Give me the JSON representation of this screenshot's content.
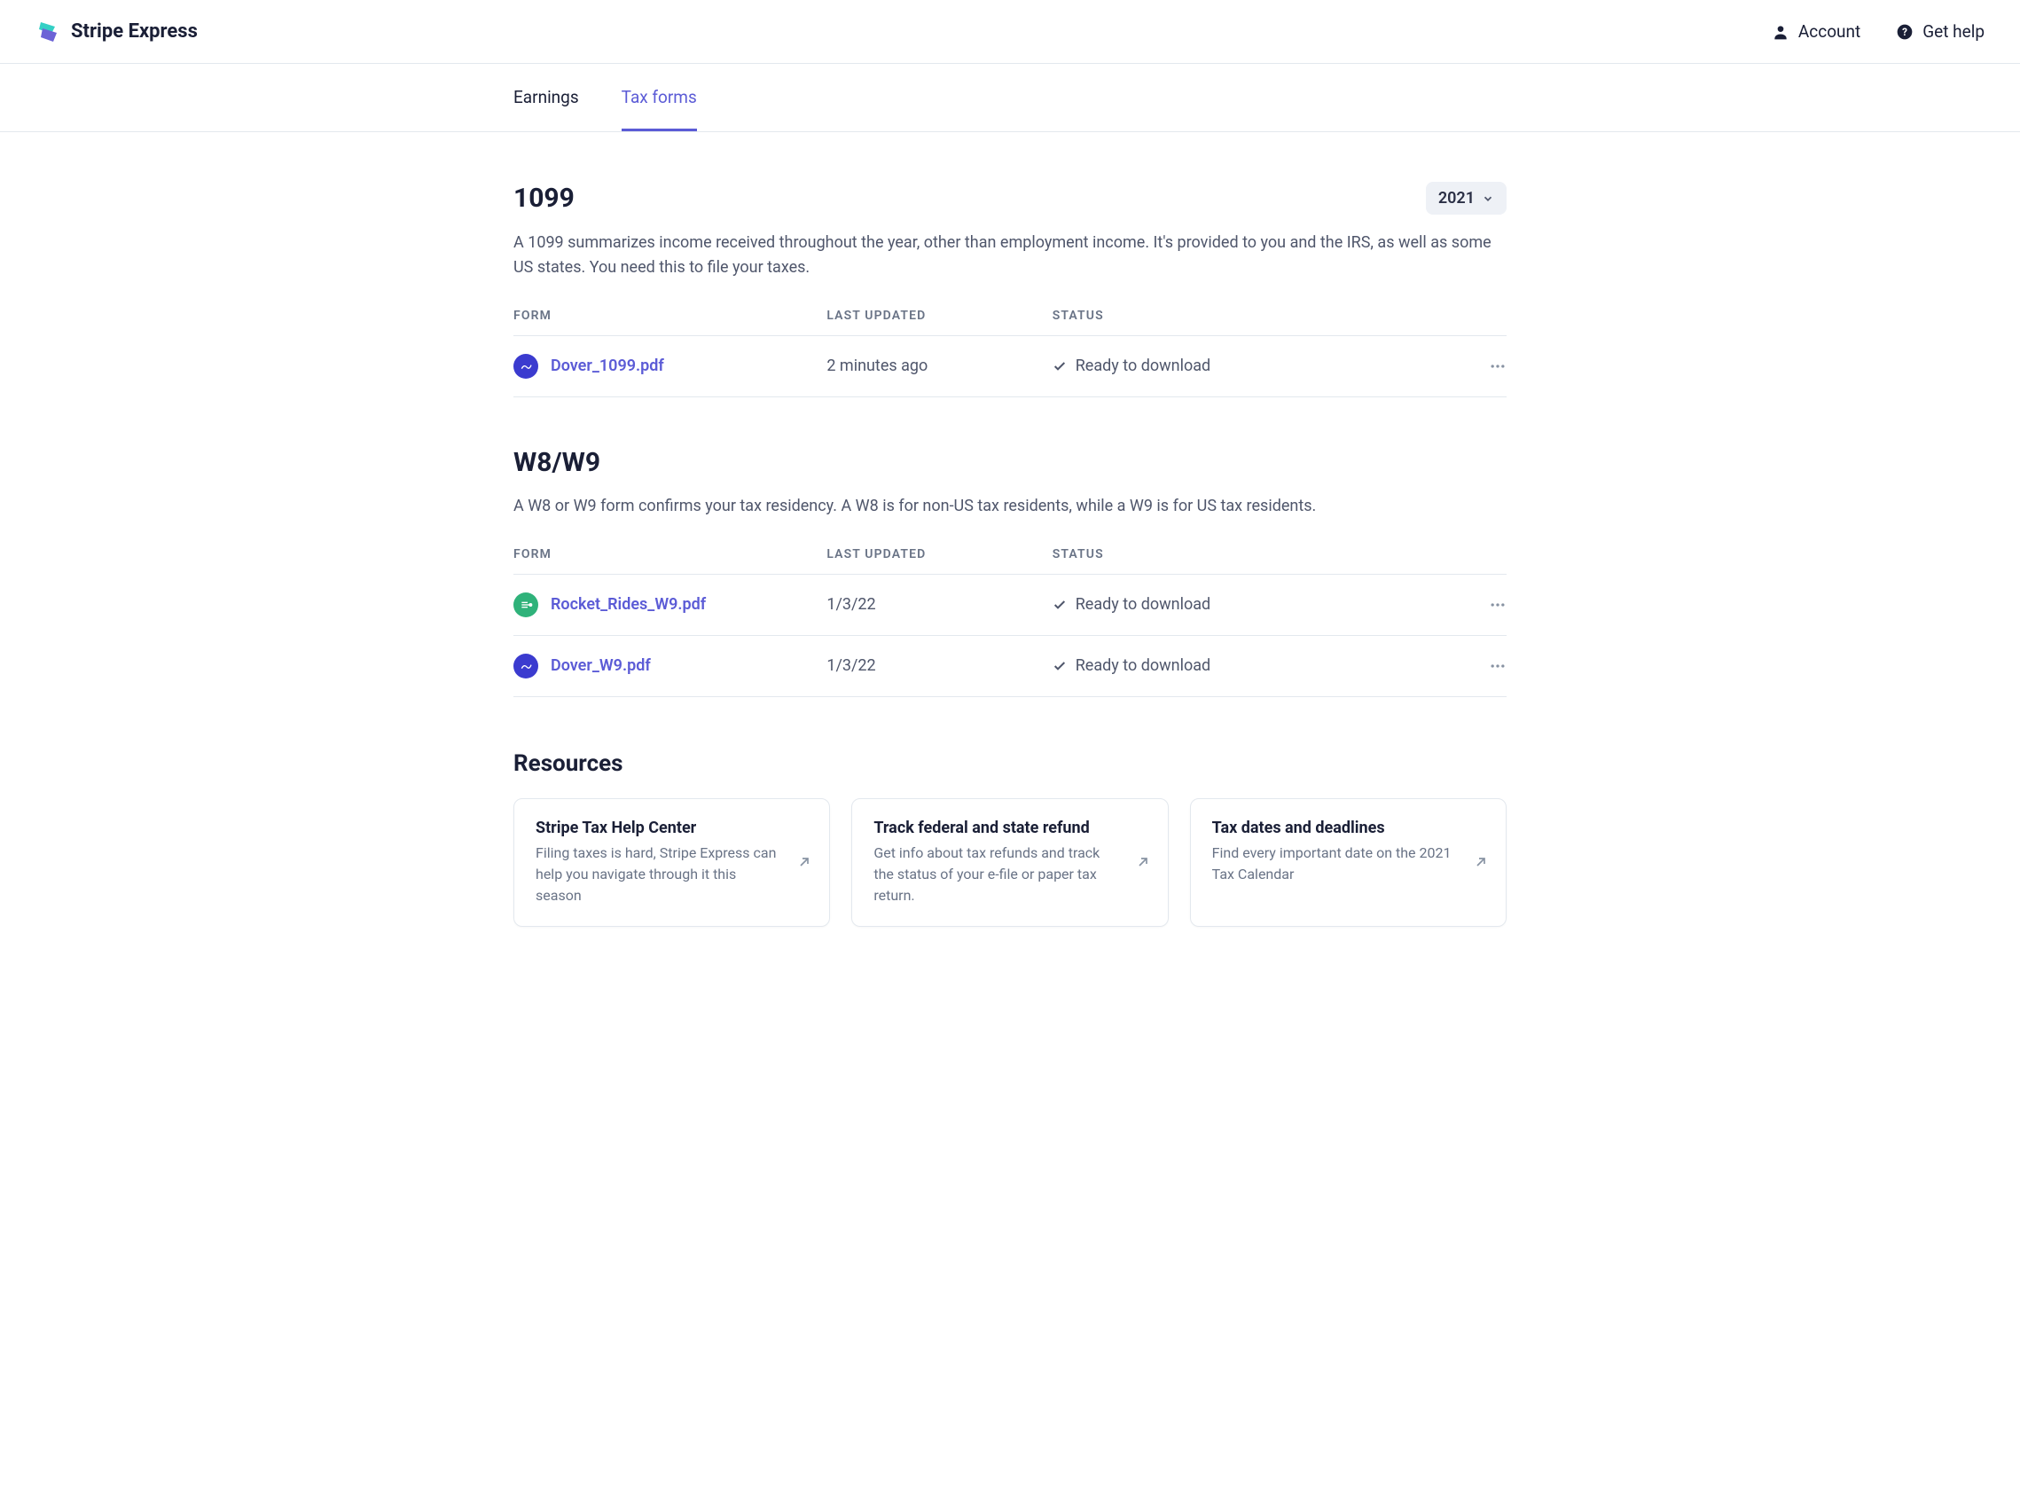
{
  "brand": {
    "name": "Stripe Express"
  },
  "header": {
    "account": "Account",
    "help": "Get help"
  },
  "tabs": [
    {
      "label": "Earnings",
      "active": false
    },
    {
      "label": "Tax forms",
      "active": true
    }
  ],
  "year_selector": "2021",
  "sections": {
    "s1099": {
      "title": "1099",
      "description": "A 1099 summarizes income received throughout the year, other than employment income. It's provided to you and the IRS, as well as some US states. You need this to file your taxes.",
      "columns": {
        "form": "FORM",
        "updated": "LAST UPDATED",
        "status": "STATUS"
      },
      "rows": [
        {
          "file": "Dover_1099.pdf",
          "avatar": "blue",
          "updated": "2 minutes ago",
          "status": "Ready to download"
        }
      ]
    },
    "w8w9": {
      "title": "W8/W9",
      "description": "A W8 or W9 form confirms your tax residency. A W8 is for non-US tax residents, while a W9 is for US tax residents.",
      "columns": {
        "form": "FORM",
        "updated": "LAST UPDATED",
        "status": "STATUS"
      },
      "rows": [
        {
          "file": "Rocket_Rides_W9.pdf",
          "avatar": "green",
          "updated": "1/3/22",
          "status": "Ready to download"
        },
        {
          "file": "Dover_W9.pdf",
          "avatar": "blue",
          "updated": "1/3/22",
          "status": "Ready to download"
        }
      ]
    }
  },
  "resources": {
    "title": "Resources",
    "cards": [
      {
        "title": "Stripe Tax Help Center",
        "desc": "Filing taxes is hard, Stripe Express can help you navigate through it this season"
      },
      {
        "title": "Track federal and state refund",
        "desc": "Get info about tax refunds and track the status of your e-file or paper tax return."
      },
      {
        "title": "Tax dates and deadlines",
        "desc": "Find every important date on the 2021 Tax Calendar"
      }
    ]
  }
}
